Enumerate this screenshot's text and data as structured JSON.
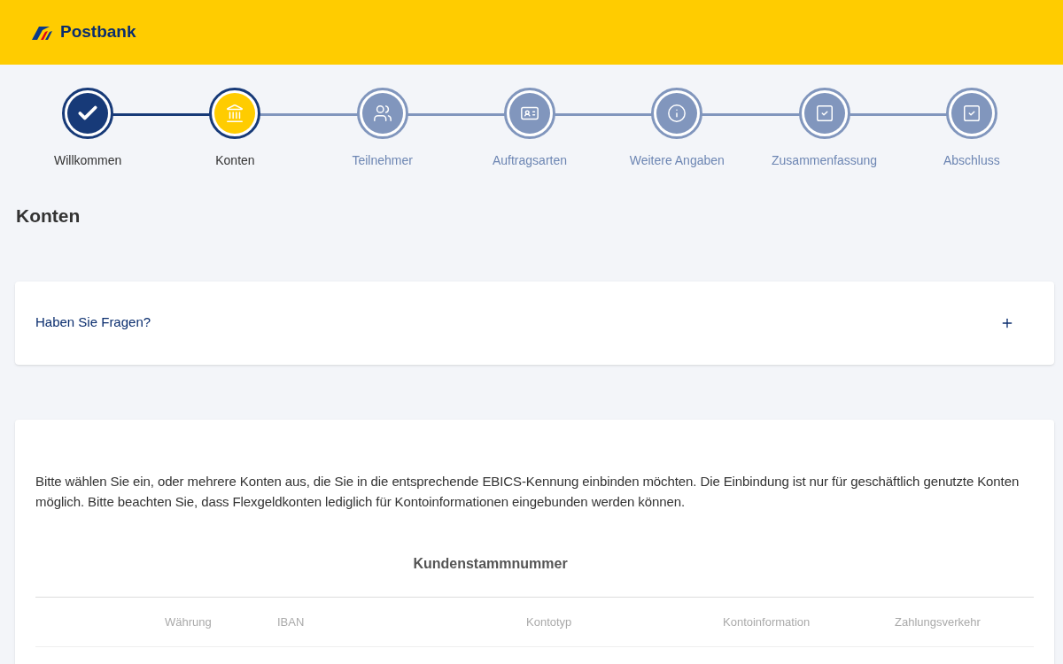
{
  "header": {
    "brand": "Postbank"
  },
  "steps": [
    {
      "label": "Willkommen",
      "done": true,
      "selected": false
    },
    {
      "label": "Konten",
      "done": false,
      "selected": true
    },
    {
      "label": "Teilnehmer",
      "done": false,
      "selected": false
    },
    {
      "label": "Auftragsarten",
      "done": false,
      "selected": false
    },
    {
      "label": "Weitere Angaben",
      "done": false,
      "selected": false
    },
    {
      "label": "Zusammenfassung",
      "done": false,
      "selected": false
    },
    {
      "label": "Abschluss",
      "done": false,
      "selected": false
    }
  ],
  "page_title": "Konten",
  "faq": {
    "label": "Haben Sie Fragen?",
    "expanded": false
  },
  "intro": "Bitte wählen Sie ein, oder mehrere Konten aus, die Sie in die entsprechende EBICS-Kennung einbinden möchten. Die Einbindung ist nur für geschäftlich genutzte Konten möglich. Bitte beachten Sie, dass Flexgeldkonten lediglich für Kontoinformationen eingebunden werden können.",
  "table": {
    "group_heading": "Kundenstammnummer",
    "columns": [
      "Währung",
      "IBAN",
      "Kontotyp",
      "Kontoinformation",
      "Zahlungsverkehr"
    ]
  }
}
